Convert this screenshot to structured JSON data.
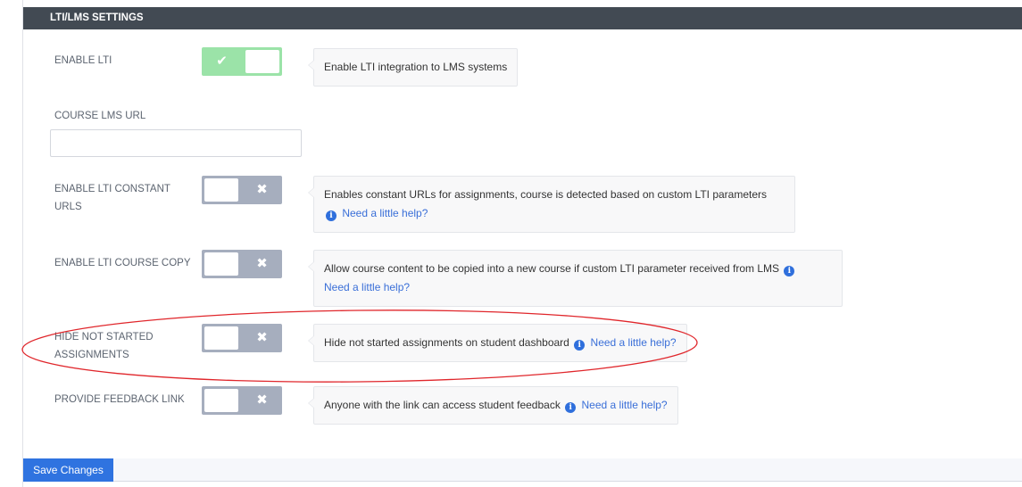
{
  "panel": {
    "title": "LTI/LMS SETTINGS"
  },
  "settings": [
    {
      "label": "ENABLE LTI",
      "toggle_state": "on",
      "toggle_glyph": "✔",
      "description": "Enable LTI integration to LMS systems"
    },
    {
      "label": "COURSE LMS URL",
      "input_value": "",
      "input_placeholder": ""
    },
    {
      "label": "ENABLE LTI CONSTANT URLS",
      "toggle_state": "off",
      "toggle_glyph": "✖",
      "description": "Enables constant URLs for assignments, course is detected based on custom LTI parameters",
      "help_link": "Need a little help?"
    },
    {
      "label": "ENABLE LTI COURSE COPY",
      "toggle_state": "off",
      "toggle_glyph": "✖",
      "description": "Allow course content to be copied into a new course if custom LTI parameter received from LMS",
      "help_link": "Need a little help?"
    },
    {
      "label": "HIDE NOT STARTED ASSIGNMENTS",
      "toggle_state": "off",
      "toggle_glyph": "✖",
      "description": "Hide not started assignments on student dashboard",
      "help_link": "Need a little help?"
    },
    {
      "label": "PROVIDE FEEDBACK LINK",
      "toggle_state": "off",
      "toggle_glyph": "✖",
      "description": "Anyone with the link can access student feedback",
      "help_link": "Need a little help?"
    }
  ],
  "icons": {
    "info": "i"
  },
  "footer": {
    "save_label": "Save Changes"
  },
  "colors": {
    "header_bg": "#424a53",
    "toggle_on": "#9be3a8",
    "toggle_off": "#a6aebe",
    "link": "#3a6fd8",
    "primary_button": "#2f73e0",
    "annotation_ellipse": "#e0262b"
  }
}
